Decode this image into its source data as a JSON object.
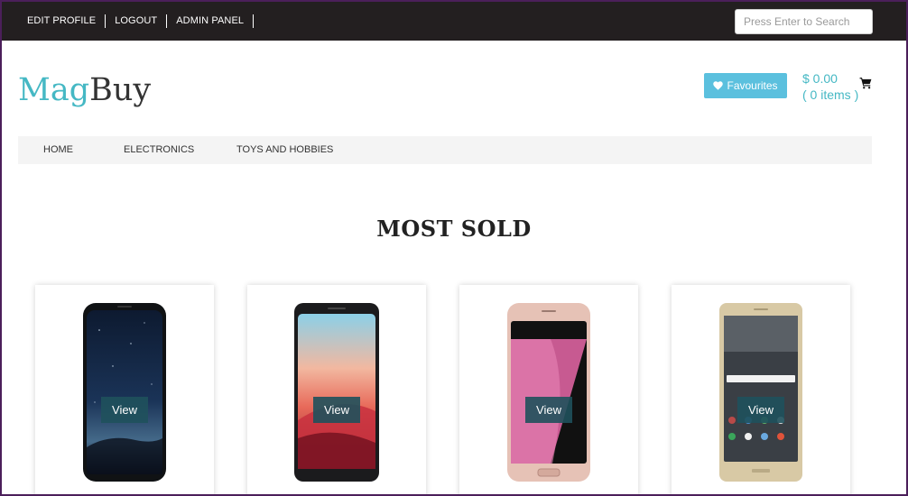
{
  "topbar": {
    "links": [
      "EDIT PROFILE",
      "LOGOUT",
      "ADMIN PANEL"
    ],
    "search_placeholder": "Press Enter to Search"
  },
  "logo": {
    "part1": "Mag",
    "part2": "Buy"
  },
  "favourites_label": "Favourites",
  "cart": {
    "amount": "$ 0.00",
    "items": "( 0 items )"
  },
  "category_nav": [
    "HOME",
    "ELECTRONICS",
    "TOYS AND HOBBIES"
  ],
  "section_title": "MOST SOLD",
  "products": [
    {
      "view_label": "View"
    },
    {
      "view_label": "View"
    },
    {
      "view_label": "View"
    },
    {
      "view_label": "View"
    }
  ],
  "colors": {
    "topbar_bg": "#231f20",
    "accent": "#45b8c4",
    "favourites_bg": "#5bc0de",
    "view_button_bg": "#1f515c",
    "nav_bg": "#f4f4f4"
  },
  "icons": [
    "heart-icon",
    "cart-icon"
  ]
}
